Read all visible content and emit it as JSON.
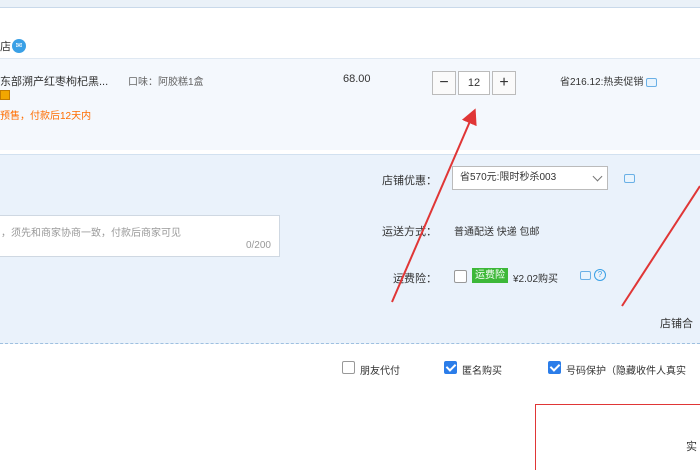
{
  "shop": {
    "label": "店",
    "ww_icon": "chat-icon"
  },
  "item": {
    "title": "东部溯产红枣枸杞黑...",
    "sku": "口味：阿胶糕1盒",
    "presale": "预售，付款后12天内",
    "price": "68.00",
    "quantity": "12",
    "minus_label": "−",
    "plus_label": "+",
    "discount": "省216.12:热卖促销"
  },
  "memo": {
    "placeholder": "，须先和商家协商一致，付款后商家可见",
    "count": "0/200"
  },
  "options": {
    "coupon_label": "店铺优惠：",
    "coupon_value": "省570元:限时秒杀003",
    "shipping_label": "运送方式：",
    "shipping_value": "普通配送 快递 包邮",
    "insurance_label": "运费险：",
    "insurance_tag": "运费险",
    "insurance_price": "¥2.02购买",
    "shop_total_label": "店铺合"
  },
  "bottom": {
    "friend_pay": "朋友代付",
    "anonymous": "匿名购买",
    "privacy": "号码保护（隐藏收件人真实"
  },
  "right_box_text": "实",
  "colors": {
    "accent": "#2b7de9",
    "annotation": "#e03636",
    "warning": "#ff6d00",
    "green_tag": "#3db838"
  }
}
